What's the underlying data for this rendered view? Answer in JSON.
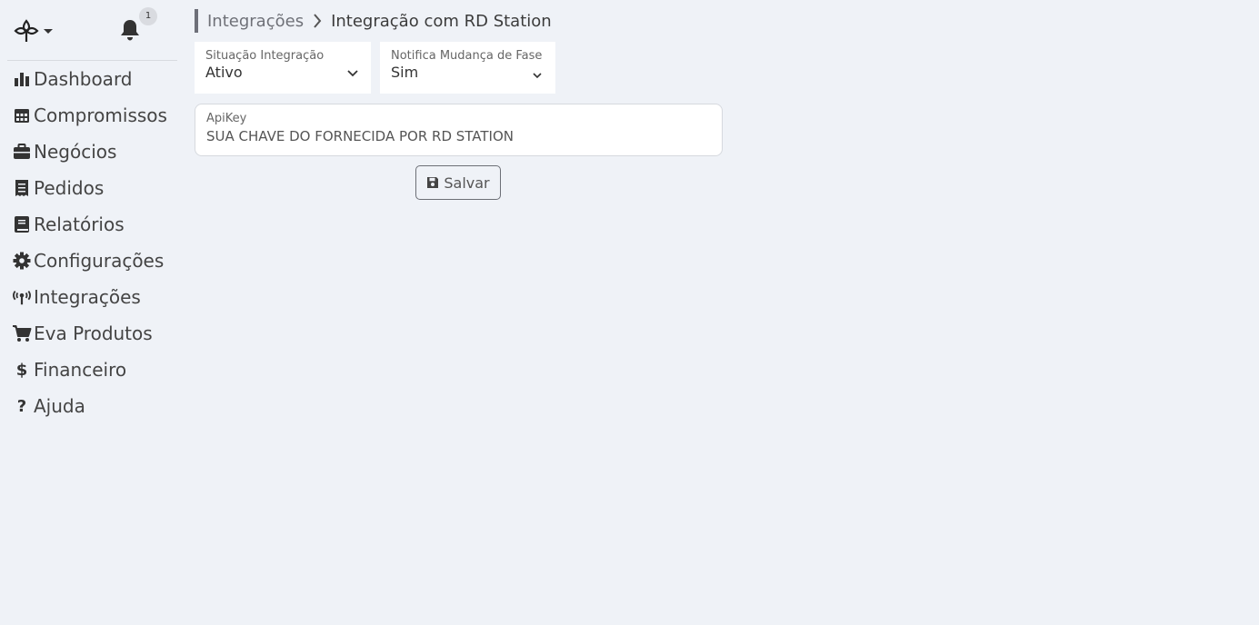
{
  "header": {
    "notification_count": "1"
  },
  "sidebar": {
    "items": [
      {
        "label": "Dashboard",
        "icon": "bar-chart-icon"
      },
      {
        "label": "Compromissos",
        "icon": "calendar-icon"
      },
      {
        "label": "Negócios",
        "icon": "briefcase-icon"
      },
      {
        "label": "Pedidos",
        "icon": "receipt-icon"
      },
      {
        "label": "Relatórios",
        "icon": "book-icon"
      },
      {
        "label": "Configurações",
        "icon": "gear-icon"
      },
      {
        "label": "Integrações",
        "icon": "antenna-icon"
      },
      {
        "label": "Eva Produtos",
        "icon": "cart-icon"
      },
      {
        "label": "Financeiro",
        "icon": "dollar-icon"
      },
      {
        "label": "Ajuda",
        "icon": "question-icon"
      }
    ]
  },
  "breadcrumb": {
    "parent": "Integrações",
    "current": "Integração com RD Station"
  },
  "form": {
    "situacao": {
      "label": "Situação Integração",
      "value": "Ativo"
    },
    "notifica": {
      "label": "Notifica Mudança de Fase",
      "value": "Sim"
    },
    "apikey": {
      "label": "ApiKey",
      "value": "SUA CHAVE DO FORNECIDA POR RD STATION"
    },
    "save_label": "Salvar"
  },
  "colors": {
    "background": "#eff2f7",
    "text": "#4a4a4a",
    "breadcrumb_bar": "#6e7079"
  }
}
